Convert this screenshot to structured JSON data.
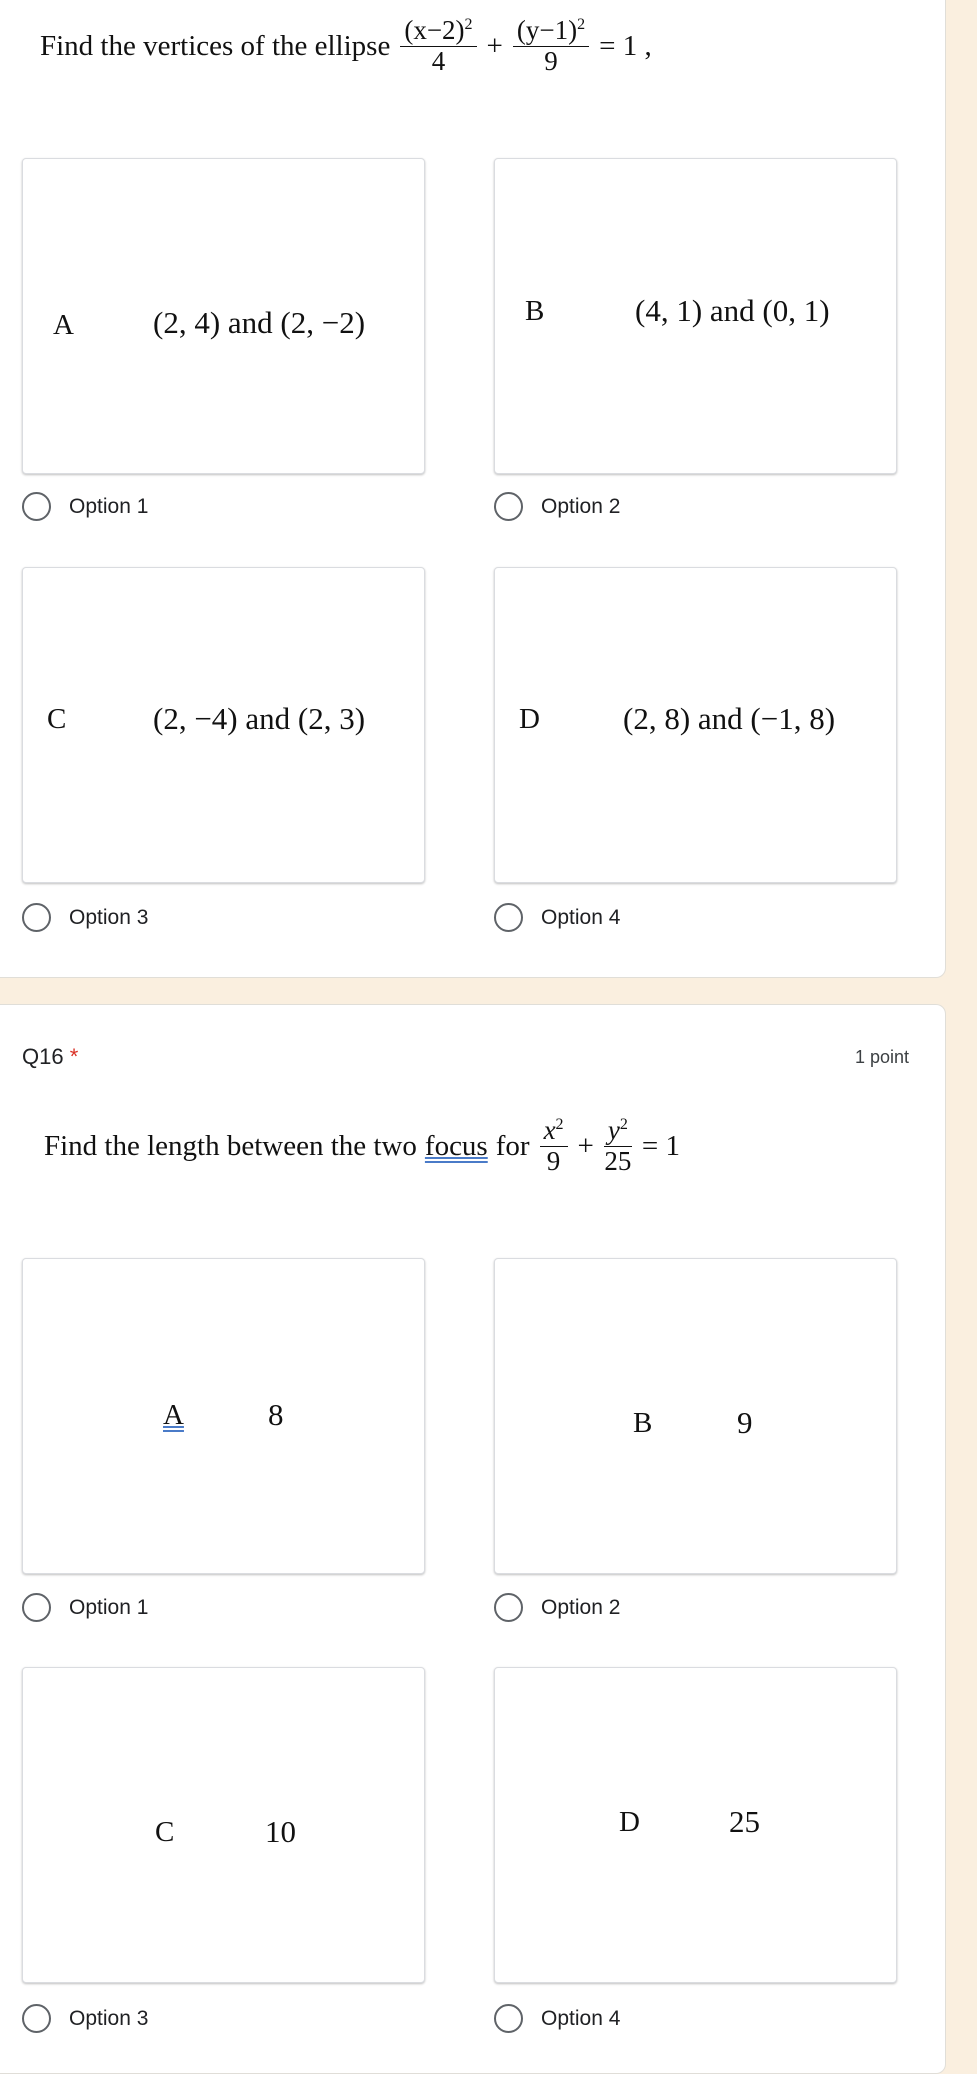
{
  "q15": {
    "question": "Find the vertices of the ellipse",
    "eq": {
      "n1": "(x−2)",
      "n2": "(y−1)",
      "exp": "2",
      "d1": "4",
      "d2": "9",
      "plus": "+",
      "rhs": "= 1 ,"
    },
    "options": [
      {
        "letter": "A",
        "value": "(2, 4) and (2, −2)",
        "radio": "Option 1"
      },
      {
        "letter": "B",
        "value": "(4, 1) and (0, 1)",
        "radio": "Option 2"
      },
      {
        "letter": "C",
        "value": "(2, −4) and (2, 3)",
        "radio": "Option 3"
      },
      {
        "letter": "D",
        "value": "(2, 8) and (−1, 8)",
        "radio": "Option 4"
      }
    ]
  },
  "q16": {
    "number": "Q16",
    "required": "*",
    "points": "1 point",
    "question_pre": "Find the length between the two",
    "question_focus": "focus",
    "question_post": "for",
    "eq": {
      "n1": "x",
      "n2": "y",
      "exp": "2",
      "d1": "9",
      "d2": "25",
      "plus": "+",
      "rhs": "= 1"
    },
    "options": [
      {
        "letter": "A",
        "value": "8",
        "radio": "Option 1"
      },
      {
        "letter": "B",
        "value": "9",
        "radio": "Option 2"
      },
      {
        "letter": "C",
        "value": "10",
        "radio": "Option 3"
      },
      {
        "letter": "D",
        "value": "25",
        "radio": "Option 4"
      }
    ]
  }
}
